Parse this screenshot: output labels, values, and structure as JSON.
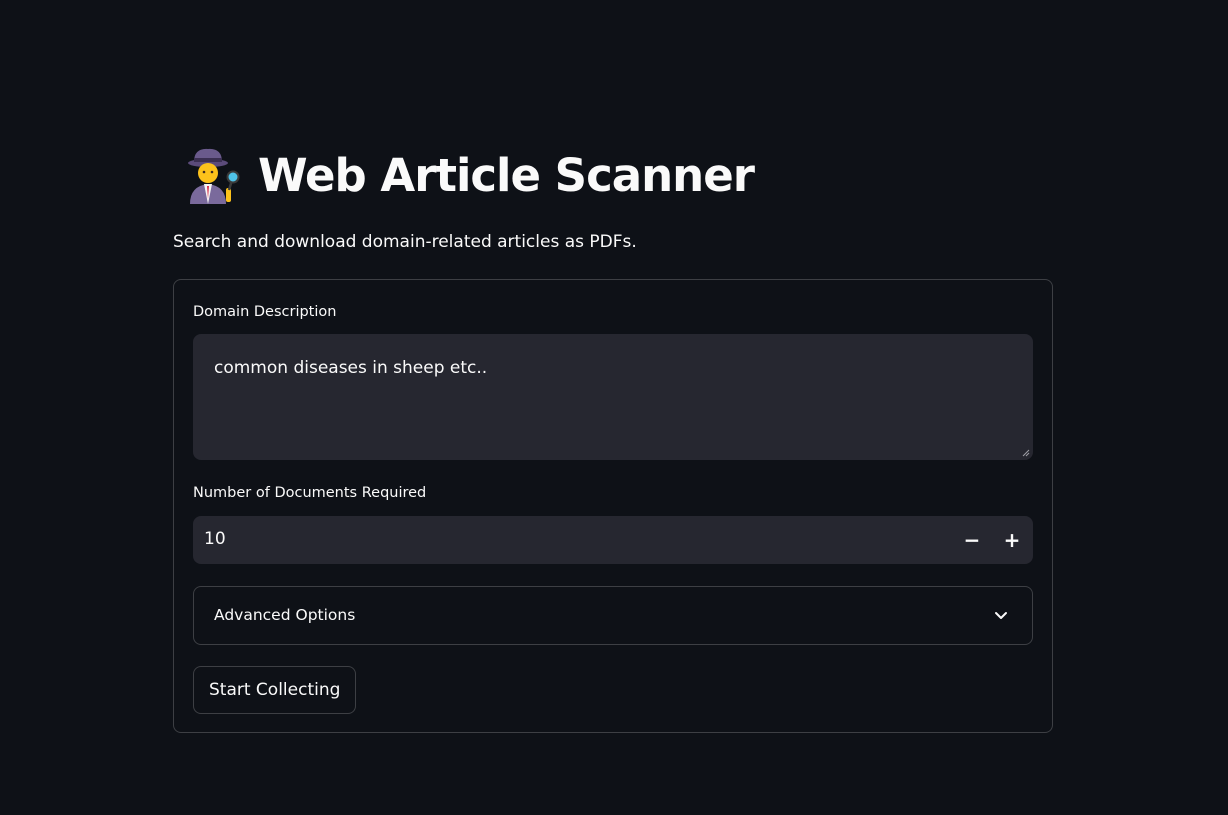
{
  "header": {
    "title": "Web Article Scanner",
    "icon": "detective-icon",
    "subtitle": "Search and download domain-related articles as PDFs."
  },
  "form": {
    "domain_description": {
      "label": "Domain Description",
      "value": "common diseases in sheep etc.."
    },
    "num_documents": {
      "label": "Number of Documents Required",
      "value": "10",
      "decrement_symbol": "−",
      "increment_symbol": "+"
    },
    "advanced_options": {
      "label": "Advanced Options",
      "expanded": false
    },
    "submit_label": "Start Collecting"
  },
  "colors": {
    "background": "#0e1117",
    "input_background": "#262730",
    "text": "#fafafa",
    "border": "rgba(250,250,250,0.2)"
  }
}
